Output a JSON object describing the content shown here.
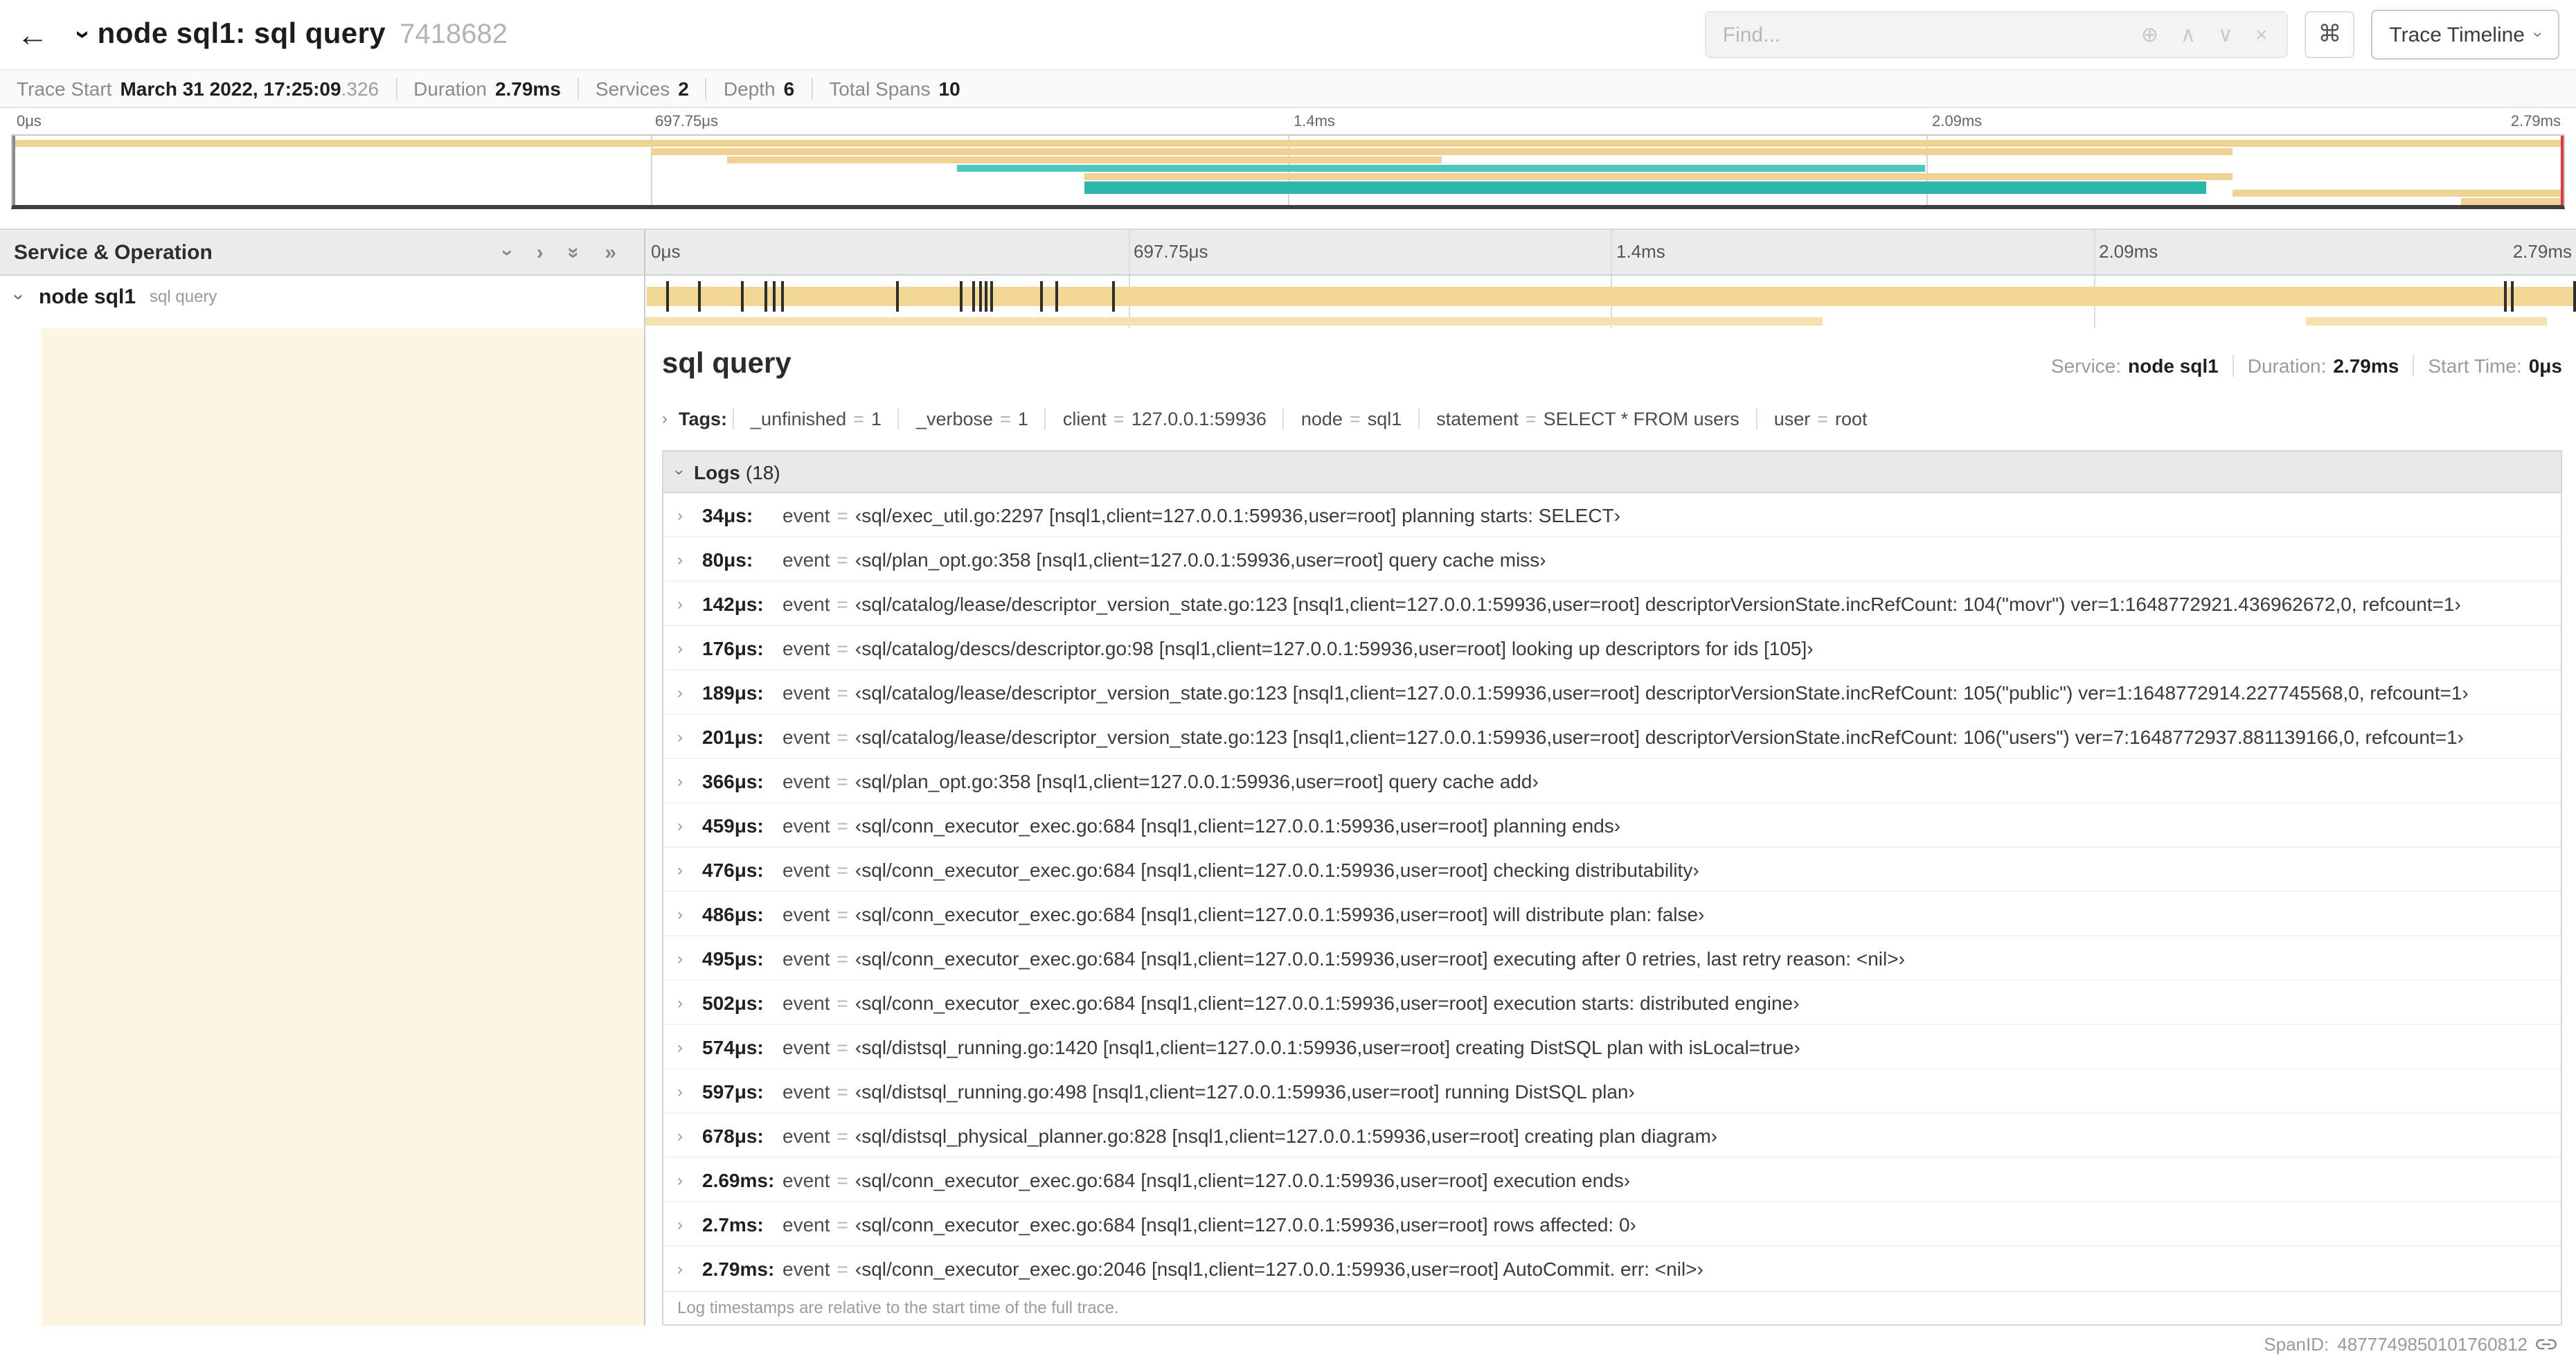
{
  "glyphs": {
    "eq": "=",
    "back_icon": "←",
    "chevron": "›",
    "double_chevron": "»",
    "zoom_icon": "⊕",
    "prev_icon": "∧",
    "next_icon": "∨",
    "clear_icon": "×",
    "cmd_icon": "⌘"
  },
  "header": {
    "title": "node sql1: sql query",
    "trace_id": "7418682",
    "find_placeholder": "Find...",
    "view_button": "Trace Timeline"
  },
  "summary": [
    {
      "label": "Trace Start",
      "value": "March 31 2022, 17:25:09",
      "suffix": ".326"
    },
    {
      "label": "Duration",
      "value": "2.79ms",
      "suffix": ""
    },
    {
      "label": "Services",
      "value": "2",
      "suffix": ""
    },
    {
      "label": "Depth",
      "value": "6",
      "suffix": ""
    },
    {
      "label": "Total Spans",
      "value": "10",
      "suffix": ""
    }
  ],
  "timeline": {
    "duration_us": 2790,
    "ticks": [
      {
        "label": "0μs",
        "pct": 0
      },
      {
        "label": "697.75μs",
        "pct": 25
      },
      {
        "label": "1.4ms",
        "pct": 50
      },
      {
        "label": "2.09ms",
        "pct": 75
      },
      {
        "label": "2.79ms",
        "pct": 100
      }
    ],
    "colors": {
      "tan": "#f0d394",
      "tan_light": "#f6e2ae",
      "teal": "#4ec8bd",
      "teal_thick": "#2cb8ad"
    },
    "minimap_bars": [
      {
        "row": 0,
        "start": 0,
        "width": 100,
        "color": "tan",
        "thick": false
      },
      {
        "row": 1,
        "start": 25,
        "width": 62,
        "color": "tan",
        "thick": false
      },
      {
        "row": 2,
        "start": 28,
        "width": 28,
        "color": "tan",
        "thick": false
      },
      {
        "row": 3,
        "start": 37,
        "width": 38,
        "color": "teal",
        "thick": false
      },
      {
        "row": 4,
        "start": 42,
        "width": 45,
        "color": "tan",
        "thick": false
      },
      {
        "row": 5,
        "start": 42,
        "width": 44,
        "color": "teal_thick",
        "thick": true
      },
      {
        "row": 6,
        "start": 87,
        "width": 13,
        "color": "tan",
        "thick": false
      },
      {
        "row": 7,
        "start": 96,
        "width": 4,
        "color": "tan",
        "thick": false
      }
    ],
    "strip_segments": [
      {
        "start": 0,
        "width": 61
      },
      {
        "start": 86,
        "width": 12.5
      }
    ]
  },
  "columns": {
    "left_header": "Service & Operation"
  },
  "span": {
    "service": "node sql1",
    "operation": "sql query",
    "detail": {
      "title": "sql query",
      "meta": [
        {
          "label": "Service:",
          "value": "node sql1"
        },
        {
          "label": "Duration:",
          "value": "2.79ms"
        },
        {
          "label": "Start Time:",
          "value": "0μs"
        }
      ]
    },
    "tags": {
      "label": "Tags:",
      "items": [
        {
          "key": "_unfinished",
          "value": "1"
        },
        {
          "key": "_verbose",
          "value": "1"
        },
        {
          "key": "client",
          "value": "127.0.0.1:59936"
        },
        {
          "key": "node",
          "value": "sql1"
        },
        {
          "key": "statement",
          "value": "SELECT * FROM users"
        },
        {
          "key": "user",
          "value": "root"
        }
      ]
    },
    "logs": {
      "label": "Logs",
      "count": "(18)",
      "footer": "Log timestamps are relative to the start time of the full trace.",
      "entries": [
        {
          "time": "34μs:",
          "time_us": 34,
          "field": "event",
          "value": "‹sql/exec_util.go:2297 [nsql1,client=127.0.0.1:59936,user=root] planning starts: SELECT›"
        },
        {
          "time": "80μs:",
          "time_us": 80,
          "field": "event",
          "value": "‹sql/plan_opt.go:358 [nsql1,client=127.0.0.1:59936,user=root] query cache miss›"
        },
        {
          "time": "142μs:",
          "time_us": 142,
          "field": "event",
          "value": "‹sql/catalog/lease/descriptor_version_state.go:123 [nsql1,client=127.0.0.1:59936,user=root] descriptorVersionState.incRefCount: 104(\"movr\") ver=1:1648772921.436962672,0, refcount=1›"
        },
        {
          "time": "176μs:",
          "time_us": 176,
          "field": "event",
          "value": "‹sql/catalog/descs/descriptor.go:98 [nsql1,client=127.0.0.1:59936,user=root] looking up descriptors for ids [105]›"
        },
        {
          "time": "189μs:",
          "time_us": 189,
          "field": "event",
          "value": "‹sql/catalog/lease/descriptor_version_state.go:123 [nsql1,client=127.0.0.1:59936,user=root] descriptorVersionState.incRefCount: 105(\"public\") ver=1:1648772914.227745568,0, refcount=1›"
        },
        {
          "time": "201μs:",
          "time_us": 201,
          "field": "event",
          "value": "‹sql/catalog/lease/descriptor_version_state.go:123 [nsql1,client=127.0.0.1:59936,user=root] descriptorVersionState.incRefCount: 106(\"users\") ver=7:1648772937.881139166,0, refcount=1›"
        },
        {
          "time": "366μs:",
          "time_us": 366,
          "field": "event",
          "value": "‹sql/plan_opt.go:358 [nsql1,client=127.0.0.1:59936,user=root] query cache add›"
        },
        {
          "time": "459μs:",
          "time_us": 459,
          "field": "event",
          "value": "‹sql/conn_executor_exec.go:684 [nsql1,client=127.0.0.1:59936,user=root] planning ends›"
        },
        {
          "time": "476μs:",
          "time_us": 476,
          "field": "event",
          "value": "‹sql/conn_executor_exec.go:684 [nsql1,client=127.0.0.1:59936,user=root] checking distributability›"
        },
        {
          "time": "486μs:",
          "time_us": 486,
          "field": "event",
          "value": "‹sql/conn_executor_exec.go:684 [nsql1,client=127.0.0.1:59936,user=root] will distribute plan: false›"
        },
        {
          "time": "495μs:",
          "time_us": 495,
          "field": "event",
          "value": "‹sql/conn_executor_exec.go:684 [nsql1,client=127.0.0.1:59936,user=root] executing after 0 retries, last retry reason: <nil>›"
        },
        {
          "time": "502μs:",
          "time_us": 502,
          "field": "event",
          "value": "‹sql/conn_executor_exec.go:684 [nsql1,client=127.0.0.1:59936,user=root] execution starts: distributed engine›"
        },
        {
          "time": "574μs:",
          "time_us": 574,
          "field": "event",
          "value": "‹sql/distsql_running.go:1420 [nsql1,client=127.0.0.1:59936,user=root] creating DistSQL plan with isLocal=true›"
        },
        {
          "time": "597μs:",
          "time_us": 597,
          "field": "event",
          "value": "‹sql/distsql_running.go:498 [nsql1,client=127.0.0.1:59936,user=root] running DistSQL plan›"
        },
        {
          "time": "678μs:",
          "time_us": 678,
          "field": "event",
          "value": "‹sql/distsql_physical_planner.go:828 [nsql1,client=127.0.0.1:59936,user=root] creating plan diagram›"
        },
        {
          "time": "2.69ms:",
          "time_us": 2690,
          "field": "event",
          "value": "‹sql/conn_executor_exec.go:684 [nsql1,client=127.0.0.1:59936,user=root] execution ends›"
        },
        {
          "time": "2.7ms:",
          "time_us": 2700,
          "field": "event",
          "value": "‹sql/conn_executor_exec.go:684 [nsql1,client=127.0.0.1:59936,user=root] rows affected: 0›"
        },
        {
          "time": "2.79ms:",
          "time_us": 2790,
          "field": "event",
          "value": "‹sql/conn_executor_exec.go:2046 [nsql1,client=127.0.0.1:59936,user=root] AutoCommit. err: <nil>›"
        }
      ]
    },
    "footer": {
      "span_id_label": "SpanID:",
      "span_id": "4877749850101760812"
    }
  }
}
